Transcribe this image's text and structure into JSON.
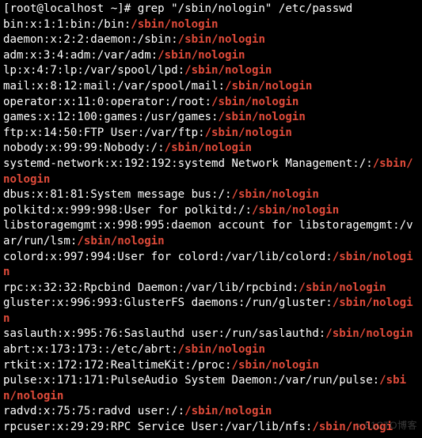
{
  "prompt": "[root@localhost ~]# ",
  "command": "grep \"/sbin/nologin\" /etc/passwd",
  "match": "/sbin/nologin",
  "watermark": "> 51CTO博客",
  "lines": [
    "bin:x:1:1:bin:/bin:/sbin/nologin",
    "daemon:x:2:2:daemon:/sbin:/sbin/nologin",
    "adm:x:3:4:adm:/var/adm:/sbin/nologin",
    "lp:x:4:7:lp:/var/spool/lpd:/sbin/nologin",
    "mail:x:8:12:mail:/var/spool/mail:/sbin/nologin",
    "operator:x:11:0:operator:/root:/sbin/nologin",
    "games:x:12:100:games:/usr/games:/sbin/nologin",
    "ftp:x:14:50:FTP User:/var/ftp:/sbin/nologin",
    "nobody:x:99:99:Nobody:/:/sbin/nologin",
    "systemd-network:x:192:192:systemd Network Management:/:/sbin/nologin",
    "dbus:x:81:81:System message bus:/:/sbin/nologin",
    "polkitd:x:999:998:User for polkitd:/:/sbin/nologin",
    "libstoragemgmt:x:998:995:daemon account for libstoragemgmt:/var/run/lsm:/sbin/nologin",
    "colord:x:997:994:User for colord:/var/lib/colord:/sbin/nologin",
    "rpc:x:32:32:Rpcbind Daemon:/var/lib/rpcbind:/sbin/nologin",
    "gluster:x:996:993:GlusterFS daemons:/run/gluster:/sbin/nologin",
    "saslauth:x:995:76:Saslauthd user:/run/saslauthd:/sbin/nologin",
    "abrt:x:173:173::/etc/abrt:/sbin/nologin",
    "rtkit:x:172:172:RealtimeKit:/proc:/sbin/nologin",
    "pulse:x:171:171:PulseAudio System Daemon:/var/run/pulse:/sbin/nologin",
    "radvd:x:75:75:radvd user:/:/sbin/nologin",
    "rpcuser:x:29:29:RPC Service User:/var/lib/nfs:/sbin/nologi"
  ]
}
